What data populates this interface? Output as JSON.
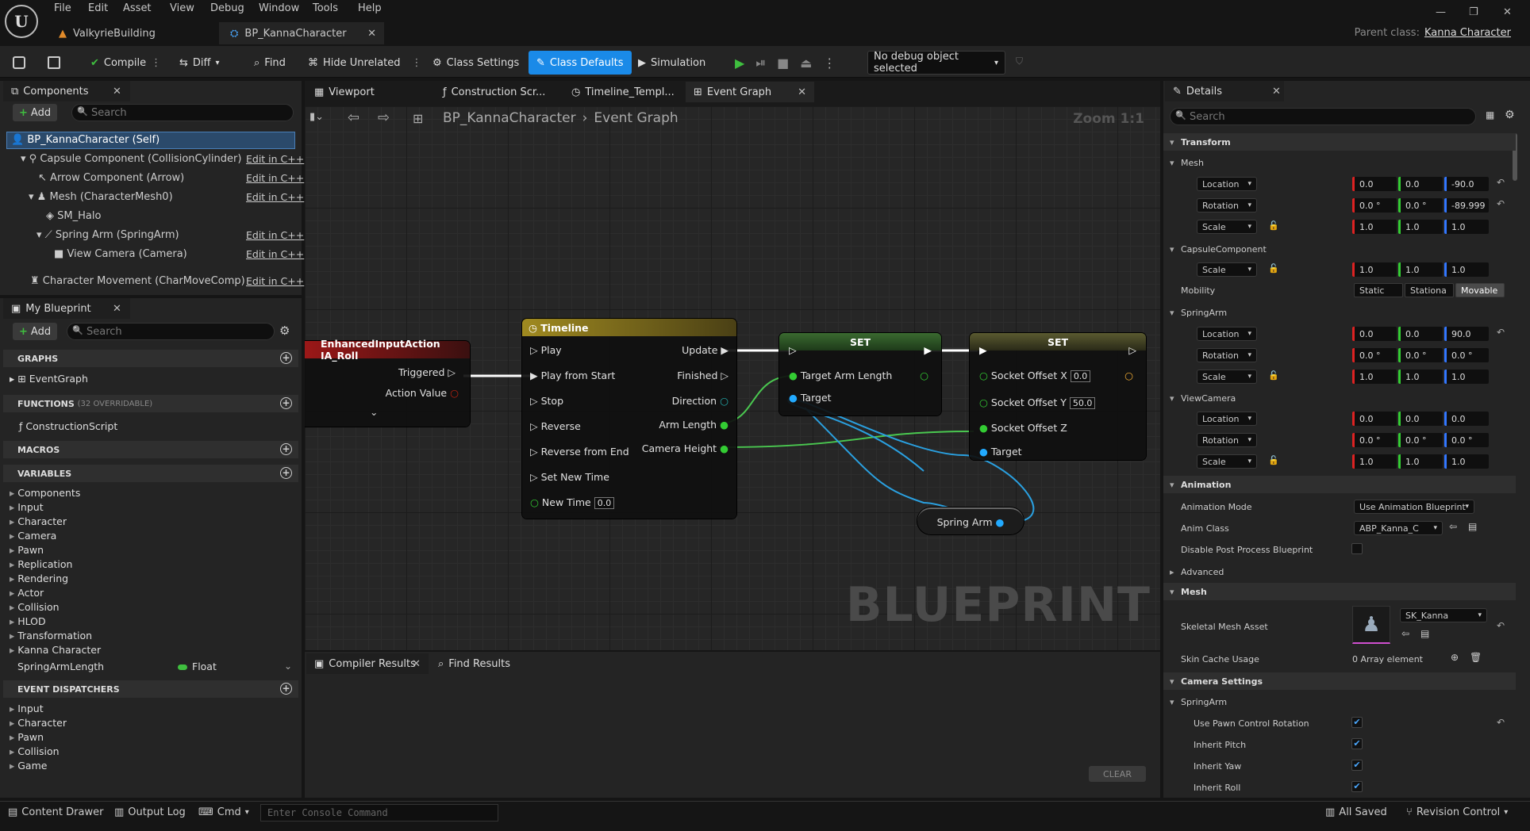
{
  "menu": [
    "File",
    "Edit",
    "Asset",
    "View",
    "Debug",
    "Window",
    "Tools",
    "Help"
  ],
  "window_controls": [
    "—",
    "❐",
    "✕"
  ],
  "doc_tabs": [
    "ValkyrieBuilding",
    "BP_KannaCharacter"
  ],
  "parent_class": {
    "label": "Parent class:",
    "value": "Kanna Character"
  },
  "toolbar": {
    "compile": "Compile",
    "diff": "Diff",
    "find": "Find",
    "hide_unrelated": "Hide Unrelated",
    "class_settings": "Class Settings",
    "class_defaults": "Class Defaults",
    "simulation": "Simulation",
    "debug_object": "No debug object selected"
  },
  "components": {
    "tab": "Components",
    "add": "Add",
    "search_placeholder": "Search",
    "items": [
      "BP_KannaCharacter (Self)",
      "Capsule Component (CollisionCylinder)",
      "Arrow Component (Arrow)",
      "Mesh (CharacterMesh0)",
      "SM_Halo",
      "Spring Arm (SpringArm)",
      "View Camera (Camera)",
      "Character Movement (CharMoveComp)"
    ],
    "edit_cpp": "Edit in C++"
  },
  "my_blueprint": {
    "tab": "My Blueprint",
    "add": "Add",
    "search_placeholder": "Search",
    "graphs": "GRAPHS",
    "event_graph": "EventGraph",
    "functions": "FUNCTIONS",
    "functions_count": "(32 OVERRIDABLE)",
    "construction_script": "ConstructionScript",
    "macros": "MACROS",
    "variables": "VARIABLES",
    "var_categories": [
      "Components",
      "Input",
      "Character",
      "Camera",
      "Pawn",
      "Replication",
      "Rendering",
      "Actor",
      "Collision",
      "HLOD",
      "Transformation",
      "Kanna Character"
    ],
    "var_name": "SpringArmLength",
    "var_type": "Float",
    "event_dispatchers": "EVENT DISPATCHERS",
    "dispatchers": [
      "Input",
      "Character",
      "Pawn",
      "Collision",
      "Game"
    ]
  },
  "graph_tabs": [
    "Viewport",
    "Construction Scr...",
    "Timeline_Templ...",
    "Event Graph"
  ],
  "breadcrumb": {
    "blueprint": "BP_KannaCharacter",
    "graph": "Event Graph",
    "zoom": "Zoom 1:1"
  },
  "watermark": "BLUEPRINT",
  "nodes": {
    "input_action": {
      "title": "EnhancedInputAction IA_Roll",
      "triggered": "Triggered",
      "action_value": "Action Value"
    },
    "timeline": {
      "title": "Timeline",
      "inputs": [
        "Play",
        "Play from Start",
        "Stop",
        "Reverse",
        "Reverse from End",
        "Set New Time",
        "New Time"
      ],
      "new_time": "0.0",
      "outputs": [
        "Update",
        "Finished",
        "Direction",
        "Arm Length",
        "Camera Height"
      ]
    },
    "set1": {
      "title": "SET",
      "pins": [
        "Target Arm Length",
        "Target"
      ]
    },
    "set2": {
      "title": "SET",
      "pins": [
        "Socket Offset X",
        "Socket Offset Y",
        "Socket Offset Z",
        "Target"
      ],
      "x": "0.0",
      "y": "50.0"
    },
    "spring_arm": "Spring Arm"
  },
  "bottom_tabs": [
    "Compiler Results",
    "Find Results"
  ],
  "clear": "CLEAR",
  "details": {
    "tab": "Details",
    "search_placeholder": "Search",
    "transform": "Transform",
    "mesh": "Mesh",
    "location": "Location",
    "rotation": "Rotation",
    "scale": "Scale",
    "mesh_loc": [
      "0.0",
      "0.0",
      "-90.0"
    ],
    "mesh_rot": [
      "0.0 °",
      "0.0 °",
      "-89.999"
    ],
    "mesh_scale": [
      "1.0",
      "1.0",
      "1.0"
    ],
    "capsule": "CapsuleComponent",
    "capsule_scale": [
      "1.0",
      "1.0",
      "1.0"
    ],
    "mobility": "Mobility",
    "mobility_opts": [
      "Static",
      "Stationa",
      "Movable"
    ],
    "springarm": "SpringArm",
    "sa_loc": [
      "0.0",
      "0.0",
      "90.0"
    ],
    "sa_rot": [
      "0.0 °",
      "0.0 °",
      "0.0 °"
    ],
    "sa_scale": [
      "1.0",
      "1.0",
      "1.0"
    ],
    "viewcamera": "ViewCamera",
    "vc_loc": [
      "0.0",
      "0.0",
      "0.0"
    ],
    "vc_rot": [
      "0.0 °",
      "0.0 °",
      "0.0 °"
    ],
    "vc_scale": [
      "1.0",
      "1.0",
      "1.0"
    ],
    "animation": "Animation",
    "anim_mode": "Animation Mode",
    "anim_mode_val": "Use Animation Blueprint",
    "anim_class": "Anim Class",
    "anim_class_val": "ABP_Kanna_C",
    "disable_pp": "Disable Post Process Blueprint",
    "advanced": "Advanced",
    "mesh2": "Mesh",
    "skeletal": "Skeletal Mesh Asset",
    "skeletal_val": "SK_Kanna",
    "skin_cache": "Skin Cache Usage",
    "skin_cache_val": "0 Array element",
    "camera_settings": "Camera Settings",
    "springarm2": "SpringArm",
    "pawn_rot": "Use Pawn Control Rotation",
    "pitch": "Inherit Pitch",
    "yaw": "Inherit Yaw",
    "roll": "Inherit Roll"
  },
  "status": {
    "content_drawer": "Content Drawer",
    "output_log": "Output Log",
    "cmd": "Cmd",
    "console_placeholder": "Enter Console Command",
    "saved": "All Saved",
    "revision": "Revision Control"
  }
}
